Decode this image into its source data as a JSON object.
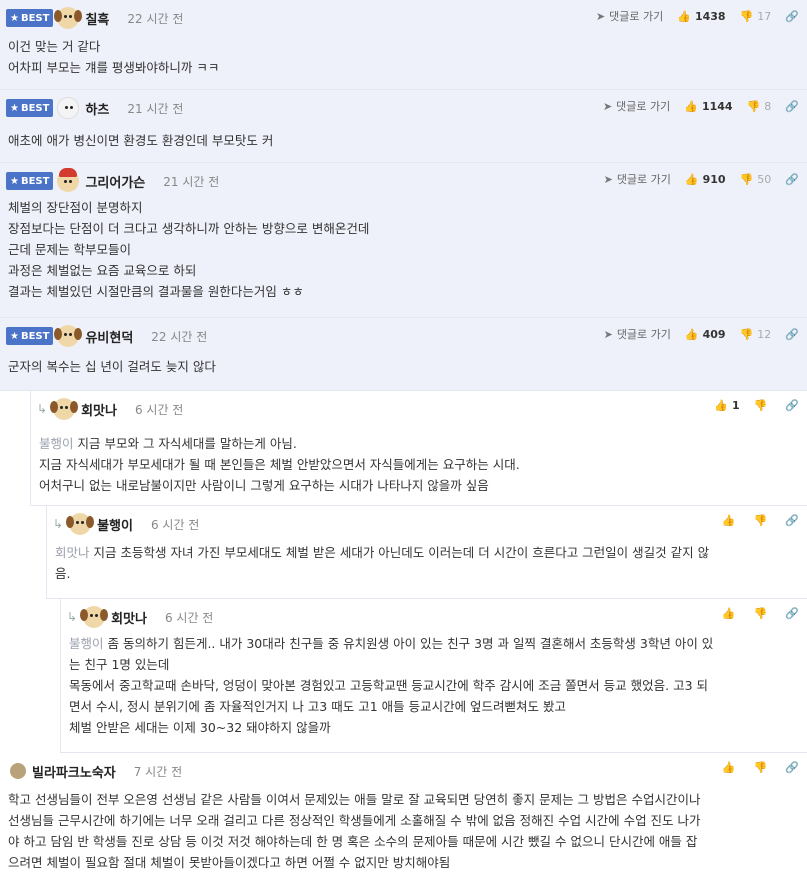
{
  "best_label": "BEST",
  "reply_link": "댓글로 가기",
  "comments": [
    {
      "nick": "칠흑",
      "time": "22 시간 전",
      "up": "1438",
      "down": "17",
      "lines": [
        "이건 맞는 거 같다",
        "어차피 부모는 걔를 평생봐야하니까 ㅋㅋ"
      ]
    },
    {
      "nick": "하츠",
      "time": "21 시간 전",
      "up": "1144",
      "down": "8",
      "lines": [
        "애초에 애가 병신이면 환경도 환경인데 부모탓도 커"
      ]
    },
    {
      "nick": "그리어가슨",
      "time": "21 시간 전",
      "up": "910",
      "down": "50",
      "lines": [
        "체벌의 장단점이 분명하지",
        "장점보다는 단점이 더 크다고 생각하니까 안하는 방향으로 변해온건데",
        "근데 문제는 학부모들이",
        "과정은 체벌없는 요즘 교육으로 하되",
        "결과는 체벌있던 시절만큼의 결과물을 원한다는거임 ㅎㅎ"
      ]
    },
    {
      "nick": "유비현덕",
      "time": "22 시간 전",
      "up": "409",
      "down": "12",
      "lines": [
        "군자의 복수는 십 년이 걸려도 늦지 않다"
      ]
    }
  ],
  "replies": [
    {
      "nick": "회맛나",
      "time": "6 시간 전",
      "up": "1",
      "mention": "불행이",
      "lines": [
        "지금 부모와 그 자식세대를 말하는게 아님.",
        "지금 자식세대가 부모세대가 될 때 본인들은 체벌 안받았으면서 자식들에게는 요구하는 시대.",
        "어처구니 없는 내로남불이지만 사람이니 그렇게 요구하는 시대가 나타나지 않을까 싶음"
      ]
    },
    {
      "nick": "불행이",
      "time": "6 시간 전",
      "mention": "회맛나",
      "lines": [
        "지금 초등학생 자녀 가진 부모세대도 체벌 받은 세대가 아닌데도 이러는데 더 시간이 흐른다고 그런일이 생길것 같지 않",
        "음."
      ]
    },
    {
      "nick": "회맛나",
      "time": "6 시간 전",
      "mention": "불행이",
      "lines": [
        "좀 동의하기 힘든게.. 내가 30대라 친구들 중 유치원생 아이 있는 친구 3명 과 일찍 결혼해서 초등학생 3학년 아이 있",
        "는 친구 1명 있는데",
        "목동에서 중고학교때 손바닥, 엉덩이 맞아본 경험있고 고등학교땐 등교시간에 학주 감시에 조금 쫄면서 등교 했었음. 고3 되",
        "면서 수시, 정시 분위기에 좀 자율적인거지 나 고3 때도 고1 애들 등교시간에 엎드려뻗쳐도 봤고",
        "체벌 안받은 세대는 이제 30~32 돼야하지 않을까"
      ]
    },
    {
      "nick": "빌라파크노숙자",
      "time": "7 시간 전",
      "lines": [
        "학고 선생님들이 전부 오은영 선생님 같은 사람들 이여서 문제있는 애들 말로 잘 교육되면 당연히 좋지 문제는 그 방법은 수업시간이나",
        "선생님들 근무시간에 하기에는 너무 오래 걸리고 다른 정상적인 학생들에게 소홀해질 수 밖에 없음 정해진 수업 시간에 수업 진도 나가",
        "야 하고 담임 반 학생들 진로 상담 등 이것 저것 해야하는데 한 명 혹은 소수의 문제아들 때문에 시간 뺐길 수 없으니 단시간에 애들 잡",
        "으려면 체벌이 필요함 절대 체벌이 못받아들이겠다고 하면 어쩔 수 없지만 방치해야됨"
      ]
    }
  ]
}
